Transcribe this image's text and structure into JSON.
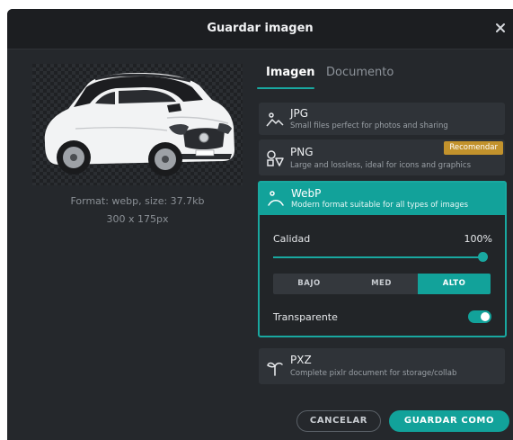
{
  "dialog": {
    "title": "Guardar imagen"
  },
  "preview": {
    "format_info": "Format: webp, size: 37.7kb",
    "dimensions": "300 x 175px"
  },
  "tabs": [
    {
      "label": "Imagen",
      "active": true
    },
    {
      "label": "Documento",
      "active": false
    }
  ],
  "formats": {
    "jpg": {
      "name": "JPG",
      "description": "Small files perfect for photos and sharing",
      "icon": "landscape-icon"
    },
    "png": {
      "name": "PNG",
      "description": "Large and lossless, ideal for icons and graphics",
      "badge": "Recomendar",
      "icon": "shapes-icon"
    },
    "webp": {
      "name": "WebP",
      "description": "Modern format suitable for all types of images",
      "icon": "web-icon",
      "selected": true
    },
    "pxz": {
      "name": "PXZ",
      "description": "Complete pixlr document for storage/collab",
      "icon": "sprout-icon"
    }
  },
  "webp_options": {
    "quality_label": "Calidad",
    "quality_value": "100%",
    "quality_fraction": 1.0,
    "presets": [
      "BAJO",
      "MED",
      "ALTO"
    ],
    "selected_preset": "ALTO",
    "transparent_label": "Transparente",
    "transparent": true
  },
  "buttons": {
    "cancel": "CANCELAR",
    "save": "GUARDAR COMO"
  },
  "colors": {
    "accent": "#12a29a",
    "badge": "#c2922c",
    "background": "#25282c"
  }
}
